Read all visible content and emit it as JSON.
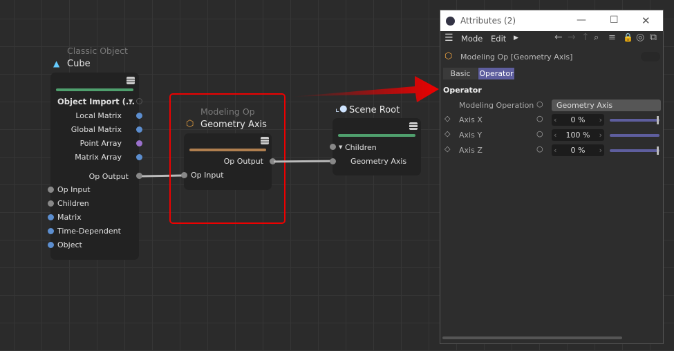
{
  "cube_node": {
    "category": "Classic Object",
    "title": "Cube",
    "header": "Object Import (...",
    "outputs": [
      "Local Matrix",
      "Global Matrix",
      "Point Array",
      "Matrix Array"
    ],
    "op_output": "Op Output",
    "inputs": [
      "Op Input",
      "Children",
      "Matrix",
      "Time-Dependent",
      "Object"
    ]
  },
  "modeling_node": {
    "category": "Modeling Op",
    "title": "Geometry Axis",
    "op_output": "Op Output",
    "op_input": "Op Input"
  },
  "scene_node": {
    "title": "Scene Root",
    "children": "Children",
    "child": "Geometry Axis"
  },
  "attributes": {
    "title": "Attributes (2)",
    "menu": [
      "Mode",
      "Edit"
    ],
    "object": "Modeling Op [Geometry Axis]",
    "tabs": [
      "Basic",
      "Operator"
    ],
    "active_tab": "Operator",
    "section": "Operator",
    "params": [
      {
        "label": "Modeling Operation",
        "value": "Geometry Axis"
      },
      {
        "label": "Axis X",
        "value": "0 %",
        "fill": 0
      },
      {
        "label": "Axis Y",
        "value": "100 %",
        "fill": 1
      },
      {
        "label": "Axis Z",
        "value": "0 %",
        "fill": 0
      }
    ]
  },
  "colors": {
    "accent": "#5e5e9e",
    "highlight": "#e00000"
  }
}
